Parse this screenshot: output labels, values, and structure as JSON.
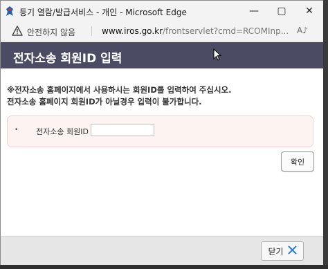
{
  "window": {
    "title": "등기 열람/발급서비스 - 개인 - Microsoft Edge",
    "controls": {
      "minimize": "—",
      "maximize": "▢",
      "close": "✕"
    }
  },
  "addressbar": {
    "security_label": "안전하지 않음",
    "url_host": "www.iros.go.kr",
    "url_path": "/frontservlet?cmd=RCOMInp...",
    "readaloud_label": "A♪"
  },
  "dialog": {
    "title": "전자소송 회원ID 입력",
    "notice_line1": "※전자소송 홈페이지에서 사용하시는 회원ID를 입력하여 주십시오.",
    "notice_line2": "전자소송 홈페이지 회원ID가 아닐경우 입력이 불가합니다.",
    "form": {
      "bullet": "•",
      "field_label": "전자소송 회원ID",
      "field_value": "",
      "field_placeholder": ""
    },
    "confirm_label": "확인"
  },
  "footer": {
    "close_label": "닫기"
  },
  "colors": {
    "header_bg": "#4b4b63",
    "form_bg": "#fdf3f1",
    "close_icon": "#2e7fd6"
  }
}
